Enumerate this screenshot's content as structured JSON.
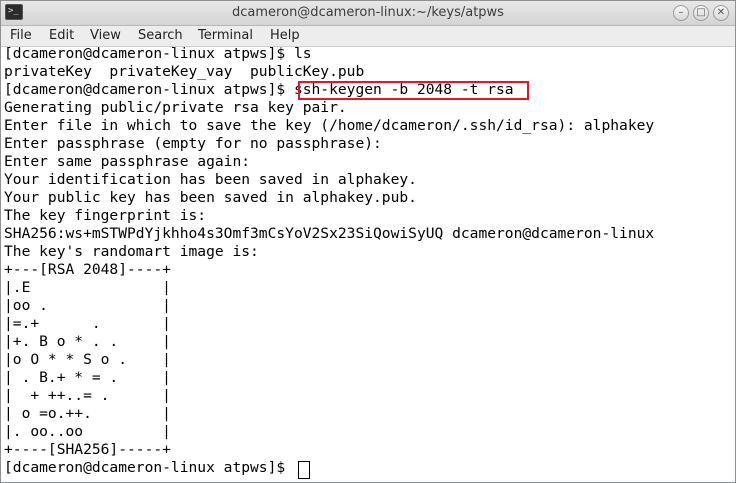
{
  "window": {
    "title": "dcameron@dcameron-linux:~/keys/atpws",
    "app_icon": "terminal-icon",
    "controls": [
      "minimize-icon",
      "maximize-icon",
      "close-icon"
    ]
  },
  "menu": {
    "file": "File",
    "edit": "Edit",
    "view": "View",
    "search": "Search",
    "terminal": "Terminal",
    "help": "Help"
  },
  "terminal": {
    "lines": [
      "[dcameron@dcameron-linux atpws]$ ls",
      "privateKey  privateKey_vay  publicKey.pub",
      "[dcameron@dcameron-linux atpws]$ ssh-keygen -b 2048 -t rsa",
      "Generating public/private rsa key pair.",
      "Enter file in which to save the key (/home/dcameron/.ssh/id_rsa): alphakey",
      "Enter passphrase (empty for no passphrase):",
      "Enter same passphrase again:",
      "Your identification has been saved in alphakey.",
      "Your public key has been saved in alphakey.pub.",
      "The key fingerprint is:",
      "SHA256:ws+mSTWPdYjkhho4s3Omf3mCsYoV2Sx23SiQowiSyUQ dcameron@dcameron-linux",
      "The key's randomart image is:",
      "+---[RSA 2048]----+",
      "|.E               |",
      "|oo .             |",
      "|=.+      .       |",
      "|+. B o * . .     |",
      "|o O * * S o .    |",
      "| . B.+ * = .     |",
      "|  + ++..= .      |",
      "| o =o.++.        |",
      "|. oo..oo         |",
      "+----[SHA256]-----+",
      "[dcameron@dcameron-linux atpws]$ "
    ],
    "highlighted_command": "ssh-keygen -b 2048 -t rsa",
    "highlight_color": "#e0182d"
  }
}
